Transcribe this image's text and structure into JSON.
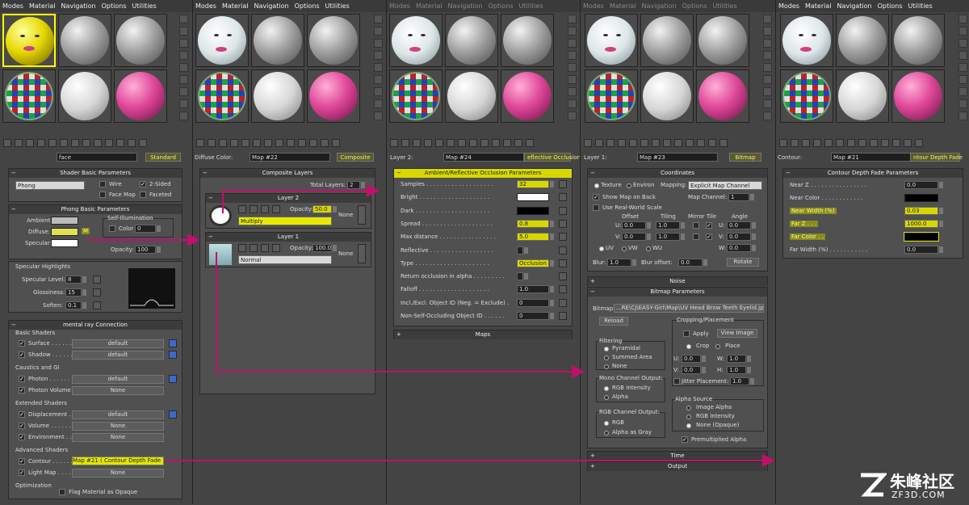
{
  "menus": [
    [
      "Modes",
      "Material",
      "Navigation",
      "Options",
      "Utilities"
    ],
    [
      "Modes",
      "Material",
      "Navigation",
      "Options",
      "Utilities"
    ],
    [
      "Modes",
      "Material",
      "Navigation",
      "Options",
      "Utilities"
    ],
    [
      "Modes",
      "Material",
      "Navigation",
      "Options",
      "Utilities"
    ],
    [
      "Modes",
      "Material",
      "Navigation",
      "Options",
      "Utilities"
    ]
  ],
  "p1": {
    "name": "face",
    "type": "Standard",
    "shader_title": "Shader Basic Parameters",
    "shader": "Phong",
    "wire": "Wire",
    "two_sided": "2-Sided",
    "face_map": "Face Map",
    "faceted": "Faceted",
    "phong_title": "Phong Basic Parameters",
    "ambient": "Ambient:",
    "diffuse": "Diffuse:",
    "specular": "Specular:",
    "self_illum": "Self-Illumination",
    "color": "Color",
    "color_val": "0",
    "opacity": "Opacity:",
    "opacity_val": "100",
    "m": "M",
    "spec_title": "Specular Highlights",
    "spec_level": "Specular Level:",
    "spec_level_val": "8",
    "gloss": "Glossiness:",
    "gloss_val": "15",
    "soften": "Soften:",
    "soften_val": "0.1",
    "mr_title": "mental ray Connection",
    "basic_shaders": "Basic Shaders",
    "surface": "Surface . . . . . .",
    "shadow": "Shadow . . . . . .",
    "default": "default",
    "caustics": "Caustics and GI",
    "photon": "Photon . . . . . .",
    "photon_vol": "Photon Volume . .",
    "none": "None",
    "extended": "Extended Shaders",
    "displacement": "Displacement . . .",
    "volume": "Volume . . . . . .",
    "environment": "Environment . . .",
    "advanced": "Advanced Shaders",
    "contour": "Contour . . . . . .",
    "contour_map": "Map #21 ( Contour Depth Fade )",
    "light_map": "Light Map . . . . .",
    "optimization": "Optimization",
    "flag_opaque": "Flag Material as Opaque"
  },
  "p2": {
    "label": "Diffuse Color:",
    "map": "Map #22",
    "type": "Composite",
    "title": "Composite Layers",
    "total_layers": "Total Layers:",
    "total_layers_val": "2",
    "layer2": "Layer 2",
    "layer2_opacity": "50.0",
    "layer2_mode": "Multiply",
    "layer1": "Layer 1",
    "layer1_opacity": "100.0",
    "layer1_mode": "Normal",
    "opacity_lbl": "Opacity:",
    "none": "None"
  },
  "p3": {
    "label": "Layer 2:",
    "map": "Map #24",
    "type": "eflective Occlusion",
    "title": "Ambient/Reflective Occlusion Parameters",
    "rows": [
      {
        "l": "Samples . . . . . . . . . . . . . . . . . . .",
        "v": "32",
        "hl": true
      },
      {
        "l": "Bright . . . . . . . . . . . . . . . . . . . .",
        "v": "",
        "sw": "#ffffff"
      },
      {
        "l": "Dark . . . . . . . . . . . . . . . . . . . . .",
        "v": "",
        "sw": "#000000"
      },
      {
        "l": "Spread . . . . . . . . . . . . . . . . . . . .",
        "v": "0.8",
        "hl": true
      },
      {
        "l": "Max distance . . . . . . . . . . . . . . . .",
        "v": "5.0",
        "hl": true
      },
      {
        "l": "Reflective . . . . . . . . . . . . . . . . . .",
        "v": ""
      },
      {
        "l": "Type . . . . . . . . . . . . . . . . . . . . .",
        "v": "Occlusion",
        "hl": true
      },
      {
        "l": "Return occlusion in alpha . . . . . . . . .",
        "v": ""
      },
      {
        "l": "Falloff . . . . . . . . . . . . . . . . . . . .",
        "v": "1.0"
      },
      {
        "l": "Incl./Excl. Object ID (Neg. = Exclude) .",
        "v": "0"
      },
      {
        "l": "Non-Self-Occluding Object ID . . . . . .",
        "v": "0"
      }
    ],
    "maps": "Maps"
  },
  "p4": {
    "label": "Layer 1:",
    "map": "Map #23",
    "type": "Bitmap",
    "coords": "Coordinates",
    "texture": "Texture",
    "environ": "Environ",
    "mapping": "Mapping:",
    "mapping_val": "Explicit Map Channel",
    "show_back": "Show Map on Back",
    "map_channel": "Map Channel:",
    "map_channel_val": "1",
    "real_world": "Use Real-World Scale",
    "offset": "Offset",
    "tiling": "Tiling",
    "mirror_tile": "Mirror Tile",
    "angle": "Angle",
    "u": "U:",
    "v": "V:",
    "w": "W:",
    "zero": "0.0",
    "one": "1.0",
    "uv": "UV",
    "vw": "VW",
    "wu": "WU",
    "blur": "Blur:",
    "blur_val": "1.0",
    "blur_offset": "Blur offset:",
    "blur_offset_val": "0.0",
    "rotate": "Rotate",
    "noise": "Noise",
    "bitmap_params": "Bitmap Parameters",
    "bitmap": "Bitmap:",
    "bitmap_path": "...RE\\CJ\\EASY-Girl\\Map\\UV Head Brow Teeth Eyelid.jpg",
    "reload": "Reload",
    "cropping": "Cropping/Placement",
    "apply": "Apply",
    "view_image": "View Image",
    "crop": "Crop",
    "place": "Place",
    "w_lbl": "W:",
    "h_lbl": "H:",
    "jitter": "Jitter Placement:",
    "jitter_val": "1.0",
    "filtering": "Filtering",
    "pyramidal": "Pyramidal",
    "summed": "Summed Area",
    "none": "None",
    "mono": "Mono Channel Output:",
    "rgb_int": "RGB Intensity",
    "alpha": "Alpha",
    "rgb_out": "RGB Channel Output:",
    "rgb": "RGB",
    "alpha_gray": "Alpha as Gray",
    "alpha_src": "Alpha Source",
    "image_alpha": "Image Alpha",
    "rgb_int2": "RGB Intensity",
    "none_opaque": "None (Opaque)",
    "premult": "Premultiplied Alpha",
    "time": "Time",
    "output": "Output"
  },
  "p5": {
    "label": "Contour:",
    "map": "Map #21",
    "type": "ntour Depth Fade",
    "title": "Contour Depth Fade Parameters",
    "near_z": "Near Z . . . . . . . . . . . . . . . .",
    "near_z_val": "0.0",
    "near_color": "Near Color . . . . . . . . . . . .",
    "near_width": "Near Width (%)",
    "near_width_val": "0.03",
    "far_z": "Far Z . . .",
    "far_z_val": "1000.0",
    "far_color": "Far Color . .",
    "far_width": "Far Width (%) . . . . . . . . . . .",
    "far_width_val": "0.0"
  },
  "watermark": {
    "cn": "朱峰社区",
    "en": "ZF3D.COM"
  },
  "colors": {
    "highlight": "#d8d800",
    "arrow": "#c0106c",
    "selected": "#ffff00"
  }
}
